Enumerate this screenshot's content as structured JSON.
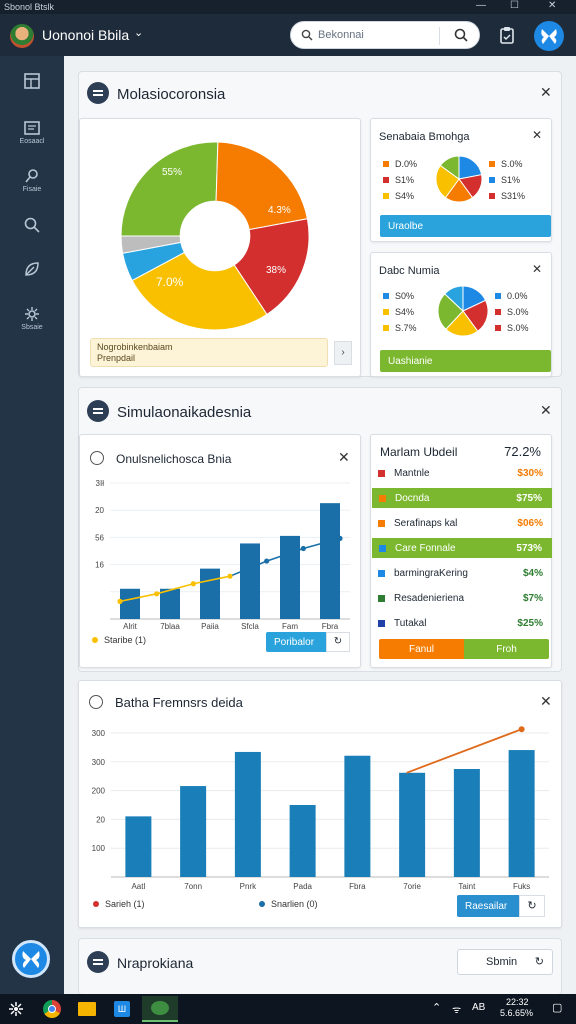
{
  "window": {
    "title": "Sbonol Btslk"
  },
  "topbar": {
    "app_name": "Uononoi Bbila",
    "search_placeholder": "Bekonnai"
  },
  "sidebar": {
    "items": [
      {
        "label": "",
        "icon": "layout-icon"
      },
      {
        "label": "Eosaacl",
        "icon": "dashboard-icon"
      },
      {
        "label": "Fisaie",
        "icon": "pin-icon"
      },
      {
        "label": "",
        "icon": "search-icon"
      },
      {
        "label": "",
        "icon": "leaf-icon"
      },
      {
        "label": "Sbsaie",
        "icon": "settings-icon"
      }
    ]
  },
  "panel1": {
    "title": "Molasiocoronsia",
    "donut": {
      "label_top_left": "55%",
      "label_right": "4.3%",
      "label_bottom_right": "38%",
      "label_left": "7.0%"
    },
    "note": {
      "line1": "Nogrobinkenbaiam",
      "line2": "Prenpdail",
      "side": "›"
    },
    "card_a": {
      "title": "Senabaia Bmohga",
      "legend": [
        {
          "label": "D.0%",
          "color": "#f57c00"
        },
        {
          "label": "S.0%",
          "color": "#f57c00"
        },
        {
          "label": "S1%",
          "color": "#d32f2f"
        },
        {
          "label": "S1%",
          "color": "#1e88e5"
        },
        {
          "label": "S4%",
          "color": "#f9c000"
        },
        {
          "label": "S31%",
          "color": "#d32f2f"
        }
      ],
      "button": "Uraolbe",
      "button_color": "#2aa3dc"
    },
    "card_b": {
      "title": "Dabc Numia",
      "legend": [
        {
          "label": "S0%",
          "color": "#1e88e5"
        },
        {
          "label": "0.0%",
          "color": "#1e88e5"
        },
        {
          "label": "S4%",
          "color": "#f9c000"
        },
        {
          "label": "S.0%",
          "color": "#d32f2f"
        },
        {
          "label": "S.7%",
          "color": "#f9c000"
        },
        {
          "label": "S.0%",
          "color": "#d32f2f"
        }
      ],
      "button": "Uashianie",
      "button_color": "#7cb82f"
    }
  },
  "panel2": {
    "title": "Simulaonaikadesnia",
    "chart": {
      "title": "Onulsnelichosca Bnia",
      "legend_label": "Staribe (1)",
      "button": "Poribalor"
    },
    "list": {
      "title": "Marlam Ubdeil",
      "total": "72.2%",
      "rows": [
        {
          "label": "Mantnle",
          "value": "$30%",
          "color": "#d32f2f",
          "value_color": "#f57c00",
          "highlight": false
        },
        {
          "label": "Docnda",
          "value": "$75%",
          "color": "#f57c00",
          "value_color": "#ffffff",
          "highlight": true
        },
        {
          "label": "Serafinaps kal",
          "value": "$06%",
          "color": "#f57c00",
          "value_color": "#f57c00",
          "highlight": false
        },
        {
          "label": "Care Fonnale",
          "value": "573%",
          "color": "#1e88e5",
          "value_color": "#ffffff",
          "highlight": true
        },
        {
          "label": "barmingraKering",
          "value": "$4%",
          "color": "#1e88e5",
          "value_color": "#2e7d32",
          "highlight": false
        },
        {
          "label": "Resadenieriena",
          "value": "$7%",
          "color": "#2e7d32",
          "value_color": "#2e7d32",
          "highlight": false
        },
        {
          "label": "Tutakal",
          "value": "$25%",
          "color": "#1e40a8",
          "value_color": "#2e7d32",
          "highlight": false
        }
      ],
      "btn_left": "Fanul",
      "btn_right": "Froh"
    }
  },
  "panel3": {
    "title": "Batha Fremnsrs deida",
    "legend_a": "Sarieh (1)",
    "legend_b": "Snarlien (0)",
    "button": "Raesailar"
  },
  "panel4": {
    "title": "Nraprokiana",
    "button": "Sbmin"
  },
  "chart_data": [
    {
      "type": "pie",
      "labels": [
        "55%",
        "4.3%",
        "38%",
        "7.0%"
      ],
      "values": [
        26,
        22,
        19,
        27,
        5,
        3
      ],
      "colors": [
        "#7cb82f",
        "#f57c00",
        "#d32f2f",
        "#f9c000",
        "#29a3e0",
        "#bdbdbd"
      ]
    },
    {
      "type": "pie",
      "values": [
        22,
        18,
        20,
        25,
        15
      ],
      "colors": [
        "#1e88e5",
        "#d32f2f",
        "#f57c00",
        "#f9c000",
        "#7cb82f"
      ]
    },
    {
      "type": "pie",
      "values": [
        18,
        22,
        22,
        25,
        13
      ],
      "colors": [
        "#1e88e5",
        "#d32f2f",
        "#f9c000",
        "#7cb82f",
        "#29a3e0"
      ]
    },
    {
      "type": "bar",
      "title": "Onulsnelichosca Bnia",
      "categories": [
        "Alrit",
        "7blaa",
        "Paiia",
        "Sfcla",
        "Fam",
        "Fbra"
      ],
      "yticks": [
        "3Ił",
        "20",
        "56",
        "16",
        ""
      ],
      "values": [
        12,
        12,
        20,
        30,
        33,
        46
      ],
      "ylim": [
        0,
        54
      ],
      "line": [
        7,
        10,
        14,
        17,
        23,
        28,
        32
      ],
      "line_colors": [
        "#f9c000",
        "#1a6fa8"
      ]
    },
    {
      "type": "bar",
      "title": "Batha Fremnsrs deida",
      "categories": [
        "Aatl",
        "7onn",
        "Pnrk",
        "Pada",
        "Fbra",
        "7orie",
        "Taint",
        "Fuks"
      ],
      "yticks": [
        "300",
        "300",
        "200",
        "20",
        "100"
      ],
      "values": [
        160,
        240,
        330,
        190,
        320,
        275,
        285,
        335
      ],
      "ylim": [
        0,
        380
      ],
      "line": [
        275,
        390
      ],
      "line_color": "#e06a1b"
    }
  ]
}
